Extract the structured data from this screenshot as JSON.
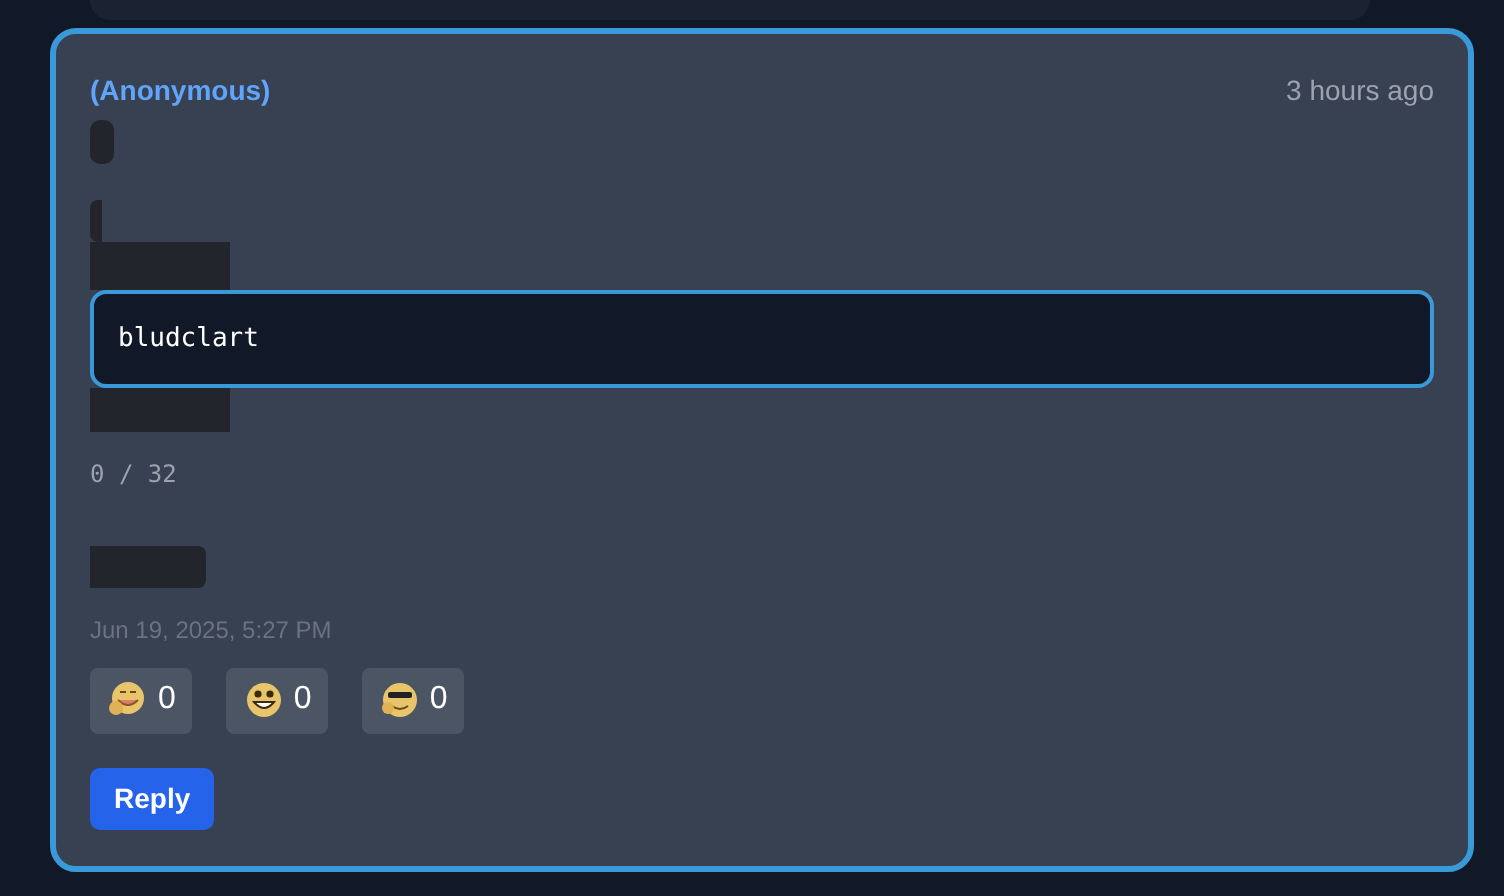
{
  "comment": {
    "author": "(Anonymous)",
    "time_ago": "3 hours ago",
    "input": {
      "value": "bludclart",
      "focused": true
    },
    "char_count": "0 / 32",
    "date": "Jun 19, 2025, 5:27 PM",
    "reactions": [
      {
        "kind": "hug",
        "count": "0"
      },
      {
        "kind": "grin",
        "count": "0"
      },
      {
        "kind": "shades",
        "count": "0"
      }
    ],
    "reply_button": "Reply"
  }
}
